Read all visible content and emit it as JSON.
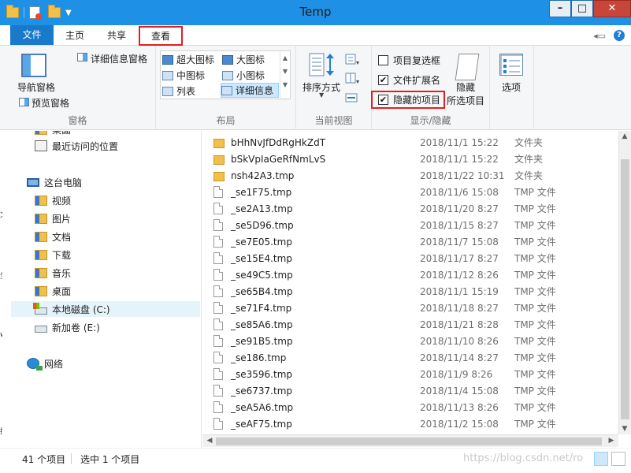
{
  "window": {
    "title": "Temp"
  },
  "tabs": {
    "file": "文件",
    "home": "主页",
    "share": "共享",
    "view": "查看"
  },
  "ribbon": {
    "panes": {
      "label": "窗格",
      "nav_pane": "导航窗格",
      "preview_pane": "预览窗格",
      "details_pane": "详细信息窗格"
    },
    "layout": {
      "label": "布局",
      "items": {
        "extra_large": "超大图标",
        "large": "大图标",
        "medium": "中图标",
        "small": "小图标",
        "list": "列表",
        "details": "详细信息"
      }
    },
    "current_view": {
      "label": "当前视图",
      "sort_by": "排序方式"
    },
    "show_hide": {
      "label": "显示/隐藏",
      "item_checkboxes": "项目复选框",
      "item_checkboxes_checked": false,
      "file_extensions": "文件扩展名",
      "file_extensions_checked": true,
      "hidden_items": "隐藏的项目",
      "hidden_items_checked": true,
      "hide_selected_line1": "隐藏",
      "hide_selected_line2": "所选项目"
    },
    "options": "选项"
  },
  "nav": {
    "partial_top": "桌面",
    "recent": "最近访问的位置",
    "this_pc": "这台电脑",
    "videos": "视频",
    "pictures": "图片",
    "documents": "文档",
    "downloads": "下载",
    "music": "音乐",
    "desktop": "桌面",
    "local_disk": "本地磁盘 (C:)",
    "new_volume": "新加卷 (E:)",
    "network": "网络"
  },
  "files": [
    {
      "name": "bHhNvJfDdRgHkZdT",
      "date": "2018/11/1 15:22",
      "type": "文件夹",
      "kind": "folder"
    },
    {
      "name": "bSkVpIaGeRfNmLvS",
      "date": "2018/11/1 15:22",
      "type": "文件夹",
      "kind": "folder"
    },
    {
      "name": "nsh42A3.tmp",
      "date": "2018/11/22 10:31",
      "type": "文件夹",
      "kind": "folder"
    },
    {
      "name": "_se1F75.tmp",
      "date": "2018/11/6 15:08",
      "type": "TMP 文件",
      "kind": "file"
    },
    {
      "name": "_se2A13.tmp",
      "date": "2018/11/20 8:27",
      "type": "TMP 文件",
      "kind": "file"
    },
    {
      "name": "_se5D96.tmp",
      "date": "2018/11/15 8:27",
      "type": "TMP 文件",
      "kind": "file"
    },
    {
      "name": "_se7E05.tmp",
      "date": "2018/11/7 15:08",
      "type": "TMP 文件",
      "kind": "file"
    },
    {
      "name": "_se15E4.tmp",
      "date": "2018/11/17 8:27",
      "type": "TMP 文件",
      "kind": "file"
    },
    {
      "name": "_se49C5.tmp",
      "date": "2018/11/12 8:26",
      "type": "TMP 文件",
      "kind": "file"
    },
    {
      "name": "_se65B4.tmp",
      "date": "2018/11/1 15:19",
      "type": "TMP 文件",
      "kind": "file"
    },
    {
      "name": "_se71F4.tmp",
      "date": "2018/11/18 8:27",
      "type": "TMP 文件",
      "kind": "file"
    },
    {
      "name": "_se85A6.tmp",
      "date": "2018/11/21 8:28",
      "type": "TMP 文件",
      "kind": "file"
    },
    {
      "name": "_se91B5.tmp",
      "date": "2018/11/10 8:26",
      "type": "TMP 文件",
      "kind": "file"
    },
    {
      "name": "_se186.tmp",
      "date": "2018/11/14 8:27",
      "type": "TMP 文件",
      "kind": "file"
    },
    {
      "name": "_se3596.tmp",
      "date": "2018/11/9 8:26",
      "type": "TMP 文件",
      "kind": "file"
    },
    {
      "name": "_se6737.tmp",
      "date": "2018/11/4 15:08",
      "type": "TMP 文件",
      "kind": "file"
    },
    {
      "name": "_seA5A6.tmp",
      "date": "2018/11/13 8:26",
      "type": "TMP 文件",
      "kind": "file"
    },
    {
      "name": "_seAF75.tmp",
      "date": "2018/11/2 15:08",
      "type": "TMP 文件",
      "kind": "file"
    }
  ],
  "status": {
    "count": "41 个项目",
    "selected": "选中 1 个项目"
  },
  "watermark": "https://blog.csdn.net/ro",
  "colors": {
    "titlebar": "#1e90e6",
    "file_tab": "#1979ca",
    "highlight_box": "#e21f1f",
    "selection": "#cce8ff"
  }
}
